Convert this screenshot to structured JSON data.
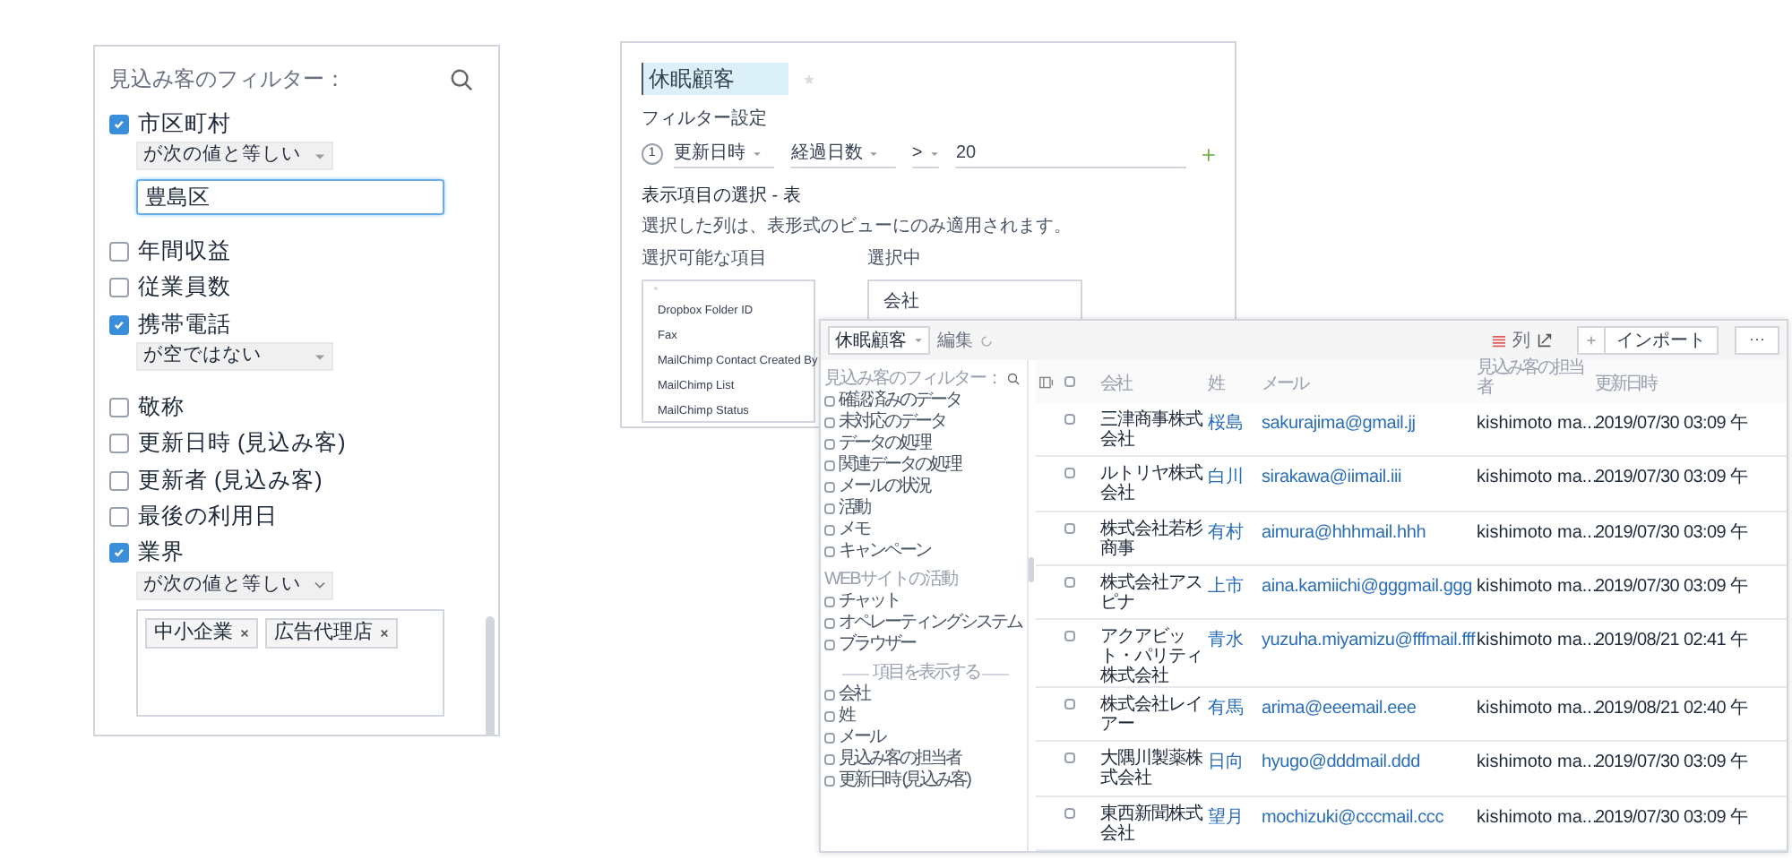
{
  "filter_panel": {
    "title": "見込み客のフィルター：",
    "filters": [
      {
        "label": "市区町村",
        "checked": true,
        "condition": {
          "kind": "text",
          "operator": "が次の値と等しい",
          "value": "豊島区"
        }
      },
      {
        "label": "年間収益",
        "checked": false
      },
      {
        "label": "従業員数",
        "checked": false
      },
      {
        "label": "携帯電話",
        "checked": true,
        "condition": {
          "kind": "none",
          "operator": "が空ではない"
        }
      },
      {
        "label": "敬称",
        "checked": false
      },
      {
        "label": "更新日時 (見込み客)",
        "checked": false
      },
      {
        "label": "更新者 (見込み客)",
        "checked": false
      },
      {
        "label": "最後の利用日",
        "checked": false
      },
      {
        "label": "業界",
        "checked": true,
        "condition": {
          "kind": "tags",
          "operator": "が次の値と等しい",
          "tags": [
            "中小企業",
            "広告代理店"
          ]
        }
      }
    ]
  },
  "view_editor": {
    "name": "休眠顧客",
    "filter_heading": "フィルター設定",
    "criteria": [
      {
        "number": "1",
        "field": "更新日時",
        "measure": "経過日数",
        "operator": ">",
        "value": "20"
      }
    ],
    "columns_heading": "表示項目の選択 - 表",
    "columns_note": "選択した列は、表形式のビューにのみ適用されます。",
    "available_label": "選択可能な項目",
    "selected_label": "選択中",
    "available": [
      "Dropbox Folder ID",
      "Fax",
      "MailChimp Contact Created By",
      "MailChimp List",
      "MailChimp Status"
    ],
    "selected": [
      "会社"
    ]
  },
  "list_view": {
    "view_name": "休眠顧客",
    "edit_link": "編集",
    "column_label": "列",
    "import_button": "インポート",
    "more_button": "···",
    "sidebar": {
      "title": "見込み客のフィルター：",
      "groups": [
        {
          "items": [
            {
              "label": "確認済みのデータ",
              "kind": "check",
              "checked": false
            },
            {
              "label": "未対応のデータ",
              "kind": "check",
              "checked": false
            },
            {
              "label": "データの処理",
              "kind": "check",
              "checked": false
            },
            {
              "label": "関連データの処理",
              "kind": "check",
              "checked": false
            },
            {
              "label": "メールの状況",
              "kind": "check",
              "checked": false
            },
            {
              "label": "活動",
              "kind": "check",
              "checked": false
            },
            {
              "label": "メモ",
              "kind": "check",
              "checked": false
            },
            {
              "label": "キャンペーン",
              "kind": "check",
              "checked": false
            }
          ]
        },
        {
          "items": [
            {
              "label": "WEBサイトの活動",
              "kind": "heading"
            },
            {
              "label": "チャット",
              "kind": "check",
              "checked": false
            },
            {
              "label": "オペレーティングシステム",
              "kind": "check",
              "checked": false
            },
            {
              "label": "ブラウザー",
              "kind": "check",
              "checked": false
            }
          ]
        },
        {
          "items": [
            {
              "label": "項目を表示する",
              "kind": "divider"
            },
            {
              "label": "会社",
              "kind": "check",
              "checked": false
            },
            {
              "label": "姓",
              "kind": "check",
              "checked": false
            },
            {
              "label": "メール",
              "kind": "check",
              "checked": false
            },
            {
              "label": "見込み客の担当者",
              "kind": "check",
              "checked": false
            },
            {
              "label": "更新日時 (見込み客)",
              "kind": "check",
              "checked": false
            }
          ]
        }
      ]
    },
    "table": {
      "all_selected": false,
      "columns": [
        "会社",
        "姓",
        "メール",
        "見込み客の担当者",
        "更新日時"
      ],
      "rows": [
        {
          "selected": false,
          "cells": [
            "三津商事株式会社",
            "桜島",
            "sakurajima@gmail.jj",
            "kishimoto ma...",
            "2019/07/30 03:09 午"
          ]
        },
        {
          "selected": false,
          "cells": [
            "ルトリヤ株式会社",
            "白川",
            "sirakawa@iimail.iii",
            "kishimoto ma...",
            "2019/07/30 03:09 午"
          ]
        },
        {
          "selected": false,
          "cells": [
            "株式会社若杉商事",
            "有村",
            "aimura@hhhmail.hhh",
            "kishimoto ma...",
            "2019/07/30 03:09 午"
          ]
        },
        {
          "selected": false,
          "cells": [
            "株式会社アスピナ",
            "上市",
            "aina.kamiichi@gggmail.ggg",
            "kishimoto ma...",
            "2019/07/30 03:09 午"
          ]
        },
        {
          "selected": false,
          "cells": [
            "アクアビット・パリティ株式会社",
            "青水",
            "yuzuha.miyamizu@fffmail.fff",
            "kishimoto ma...",
            "2019/08/21 02:41 午"
          ]
        },
        {
          "selected": false,
          "cells": [
            "株式会社レイアー",
            "有馬",
            "arima@eeemail.eee",
            "kishimoto ma...",
            "2019/08/21 02:40 午"
          ]
        },
        {
          "selected": false,
          "cells": [
            "大隅川製薬株式会社",
            "日向",
            "hyugo@dddmail.ddd",
            "kishimoto ma...",
            "2019/07/30 03:09 午"
          ]
        },
        {
          "selected": false,
          "cells": [
            "東西新聞株式会社",
            "望月",
            "mochizuki@cccmail.ccc",
            "kishimoto ma...",
            "2019/07/30 03:09 午"
          ]
        }
      ]
    }
  }
}
